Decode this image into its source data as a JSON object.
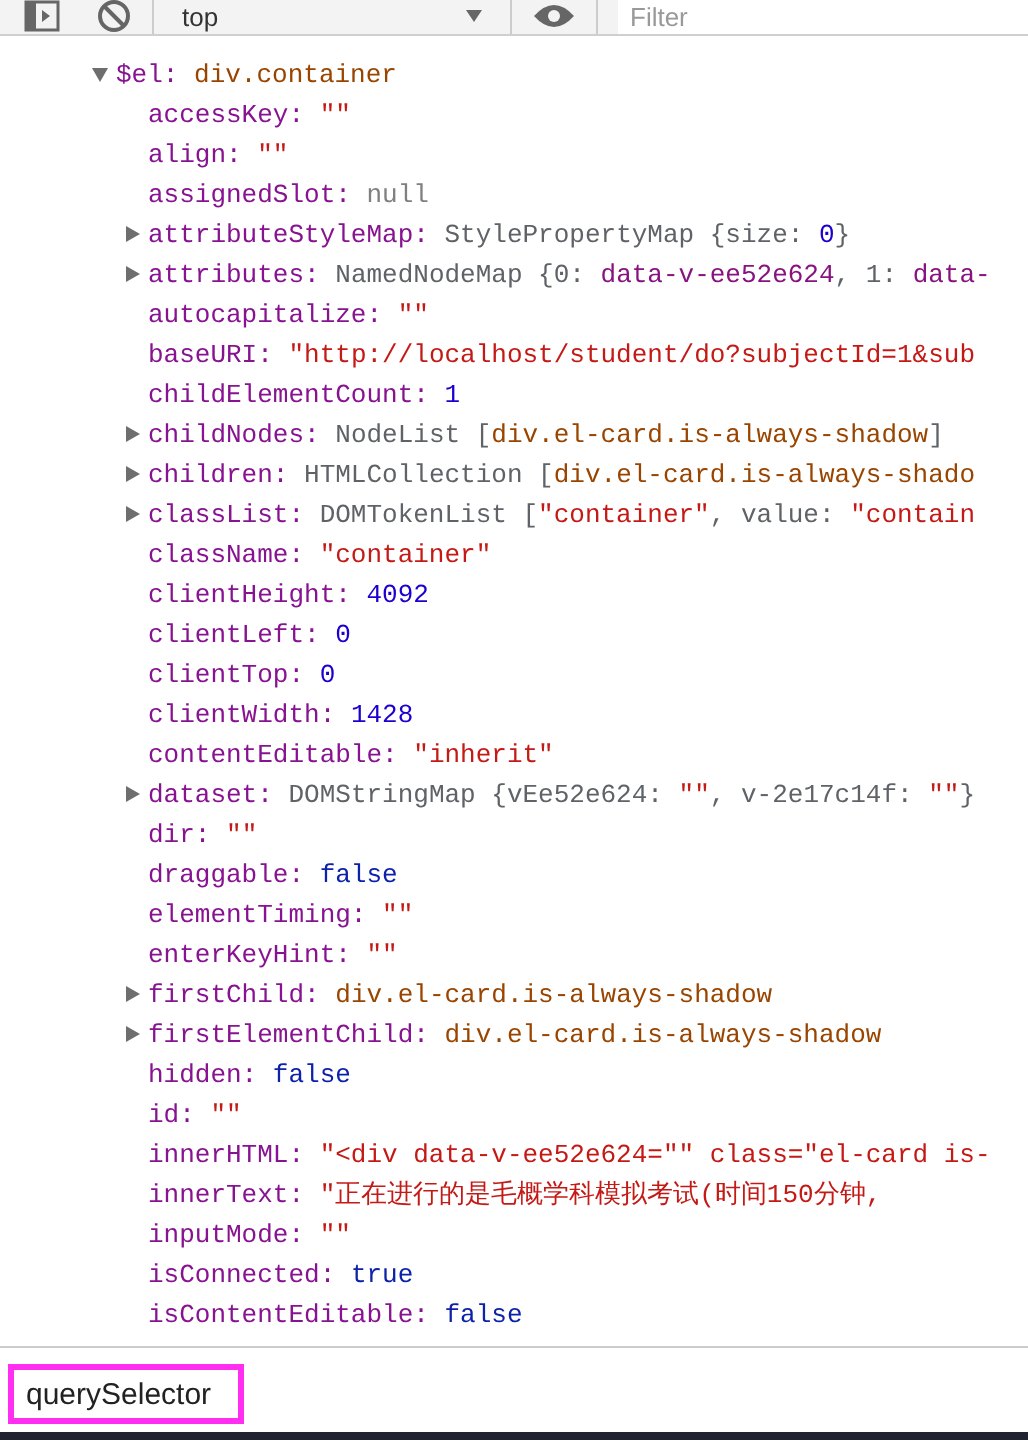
{
  "toolbar": {
    "context": "top",
    "filter_placeholder": "Filter"
  },
  "object": {
    "key": "$el:",
    "expanded": true,
    "value": [
      {
        "kind": "node",
        "text": "div.container"
      }
    ]
  },
  "properties": [
    {
      "key": "accessKey:",
      "expandable": false,
      "value": [
        {
          "kind": "string",
          "text": "\"\""
        }
      ]
    },
    {
      "key": "align:",
      "expandable": false,
      "value": [
        {
          "kind": "string",
          "text": "\"\""
        }
      ]
    },
    {
      "key": "assignedSlot:",
      "expandable": false,
      "value": [
        {
          "kind": "null",
          "text": "null"
        }
      ]
    },
    {
      "key": "attributeStyleMap:",
      "expandable": true,
      "value": [
        {
          "kind": "plain",
          "text": "StylePropertyMap {size: "
        },
        {
          "kind": "number",
          "text": "0"
        },
        {
          "kind": "plain",
          "text": "}"
        }
      ]
    },
    {
      "key": "attributes:",
      "expandable": true,
      "value": [
        {
          "kind": "plain",
          "text": "NamedNodeMap {0: "
        },
        {
          "kind": "attr",
          "text": "data-v-ee52e624"
        },
        {
          "kind": "plain",
          "text": ", 1: "
        },
        {
          "kind": "attr",
          "text": "data-"
        }
      ]
    },
    {
      "key": "autocapitalize:",
      "expandable": false,
      "value": [
        {
          "kind": "string",
          "text": "\"\""
        }
      ]
    },
    {
      "key": "baseURI:",
      "expandable": false,
      "value": [
        {
          "kind": "string",
          "text": "\"http://localhost/student/do?subjectId=1&sub"
        }
      ]
    },
    {
      "key": "childElementCount:",
      "expandable": false,
      "value": [
        {
          "kind": "number",
          "text": "1"
        }
      ]
    },
    {
      "key": "childNodes:",
      "expandable": true,
      "value": [
        {
          "kind": "plain",
          "text": "NodeList ["
        },
        {
          "kind": "node",
          "text": "div.el-card.is-always-shadow"
        },
        {
          "kind": "plain",
          "text": "]"
        }
      ]
    },
    {
      "key": "children:",
      "expandable": true,
      "value": [
        {
          "kind": "plain",
          "text": "HTMLCollection ["
        },
        {
          "kind": "node",
          "text": "div.el-card.is-always-shado"
        }
      ]
    },
    {
      "key": "classList:",
      "expandable": true,
      "value": [
        {
          "kind": "plain",
          "text": "DOMTokenList ["
        },
        {
          "kind": "string",
          "text": "\"container\""
        },
        {
          "kind": "plain",
          "text": ", value: "
        },
        {
          "kind": "string",
          "text": "\"contain"
        }
      ]
    },
    {
      "key": "className:",
      "expandable": false,
      "value": [
        {
          "kind": "string",
          "text": "\"container\""
        }
      ]
    },
    {
      "key": "clientHeight:",
      "expandable": false,
      "value": [
        {
          "kind": "number",
          "text": "4092"
        }
      ]
    },
    {
      "key": "clientLeft:",
      "expandable": false,
      "value": [
        {
          "kind": "number",
          "text": "0"
        }
      ]
    },
    {
      "key": "clientTop:",
      "expandable": false,
      "value": [
        {
          "kind": "number",
          "text": "0"
        }
      ]
    },
    {
      "key": "clientWidth:",
      "expandable": false,
      "value": [
        {
          "kind": "number",
          "text": "1428"
        }
      ]
    },
    {
      "key": "contentEditable:",
      "expandable": false,
      "value": [
        {
          "kind": "string",
          "text": "\"inherit\""
        }
      ]
    },
    {
      "key": "dataset:",
      "expandable": true,
      "value": [
        {
          "kind": "plain",
          "text": "DOMStringMap {vEe52e624: "
        },
        {
          "kind": "string",
          "text": "\"\""
        },
        {
          "kind": "plain",
          "text": ", v-2e17c14f: "
        },
        {
          "kind": "string",
          "text": "\"\""
        },
        {
          "kind": "plain",
          "text": "}"
        }
      ]
    },
    {
      "key": "dir:",
      "expandable": false,
      "value": [
        {
          "kind": "string",
          "text": "\"\""
        }
      ]
    },
    {
      "key": "draggable:",
      "expandable": false,
      "value": [
        {
          "kind": "boolean",
          "text": "false"
        }
      ]
    },
    {
      "key": "elementTiming:",
      "expandable": false,
      "value": [
        {
          "kind": "string",
          "text": "\"\""
        }
      ]
    },
    {
      "key": "enterKeyHint:",
      "expandable": false,
      "value": [
        {
          "kind": "string",
          "text": "\"\""
        }
      ]
    },
    {
      "key": "firstChild:",
      "expandable": true,
      "value": [
        {
          "kind": "node",
          "text": "div.el-card.is-always-shadow"
        }
      ]
    },
    {
      "key": "firstElementChild:",
      "expandable": true,
      "value": [
        {
          "kind": "node",
          "text": "div.el-card.is-always-shadow"
        }
      ]
    },
    {
      "key": "hidden:",
      "expandable": false,
      "value": [
        {
          "kind": "boolean",
          "text": "false"
        }
      ]
    },
    {
      "key": "id:",
      "expandable": false,
      "value": [
        {
          "kind": "string",
          "text": "\"\""
        }
      ]
    },
    {
      "key": "innerHTML:",
      "expandable": false,
      "value": [
        {
          "kind": "string",
          "text": "\"<div data-v-ee52e624=\"\" class=\"el-card is-"
        }
      ]
    },
    {
      "key": "innerText:",
      "expandable": false,
      "value": [
        {
          "kind": "string",
          "text": "\"正在进行的是毛概学科模拟考试(时间150分钟,"
        }
      ]
    },
    {
      "key": "inputMode:",
      "expandable": false,
      "value": [
        {
          "kind": "string",
          "text": "\"\""
        }
      ]
    },
    {
      "key": "isConnected:",
      "expandable": false,
      "value": [
        {
          "kind": "boolean",
          "text": "true"
        }
      ]
    },
    {
      "key": "isContentEditable:",
      "expandable": false,
      "value": [
        {
          "kind": "boolean",
          "text": "false"
        }
      ]
    }
  ],
  "console_input": {
    "value": "querySelector",
    "highlighted": true
  }
}
